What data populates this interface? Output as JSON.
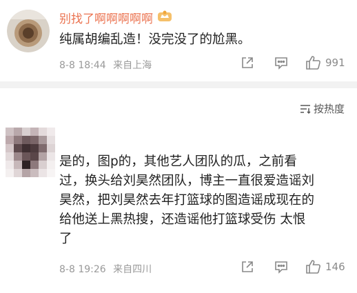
{
  "comments": [
    {
      "username": "别找了啊啊啊啊啊",
      "text": "纯属胡编乱造！没完没了的尬黑。",
      "date": "8-8 18:44",
      "location": "来自上海",
      "like_count": "991"
    },
    {
      "username": "",
      "text_lines": [
        "是的，图p的，其他艺人团队的瓜，之前看",
        "过，换头给刘昊然团队，博主一直很爱造谣刘",
        "昊然，把刘昊然去年打篮球的图造谣成现在的",
        "给他送上黑热搜，还造谣他打篮球受伤 太恨",
        "了"
      ],
      "date": "8-8 19:26",
      "location": "来自四川",
      "like_count": "146"
    }
  ],
  "sort_label": "按热度",
  "colors": {
    "username": "#eb7350",
    "meta": "#999999",
    "divider": "#f2f2f2"
  },
  "icons": [
    "crown-icon",
    "share-icon",
    "comment-icon",
    "like-icon",
    "sort-icon"
  ]
}
